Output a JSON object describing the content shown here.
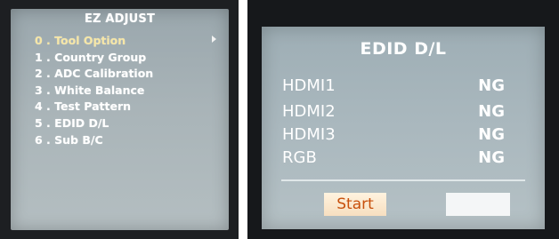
{
  "ez_adjust": {
    "title": "EZ ADJUST",
    "items": [
      {
        "label": "0 . Tool Option",
        "selected": true
      },
      {
        "label": "1 . Country Group",
        "selected": false
      },
      {
        "label": "2 . ADC Calibration",
        "selected": false
      },
      {
        "label": "3 . White Balance",
        "selected": false
      },
      {
        "label": "4 . Test Pattern",
        "selected": false
      },
      {
        "label": "5 . EDID D/L",
        "selected": false
      },
      {
        "label": "6 . Sub B/C",
        "selected": false
      }
    ],
    "submenu_icon": "triangle-right-icon"
  },
  "edid": {
    "title": "EDID D/L",
    "ports": [
      {
        "name": "HDMI1",
        "status": "NG"
      },
      {
        "name": "HDMI2",
        "status": "NG"
      },
      {
        "name": "HDMI3",
        "status": "NG"
      },
      {
        "name": "RGB",
        "status": "NG"
      }
    ],
    "start_label": "Start",
    "second_button_label": ""
  },
  "colors": {
    "selected_item": "#f6e6a6",
    "start_text": "#c8500c",
    "start_bg": "#f7dfc0",
    "screen_bg": "#a9b4b8"
  }
}
